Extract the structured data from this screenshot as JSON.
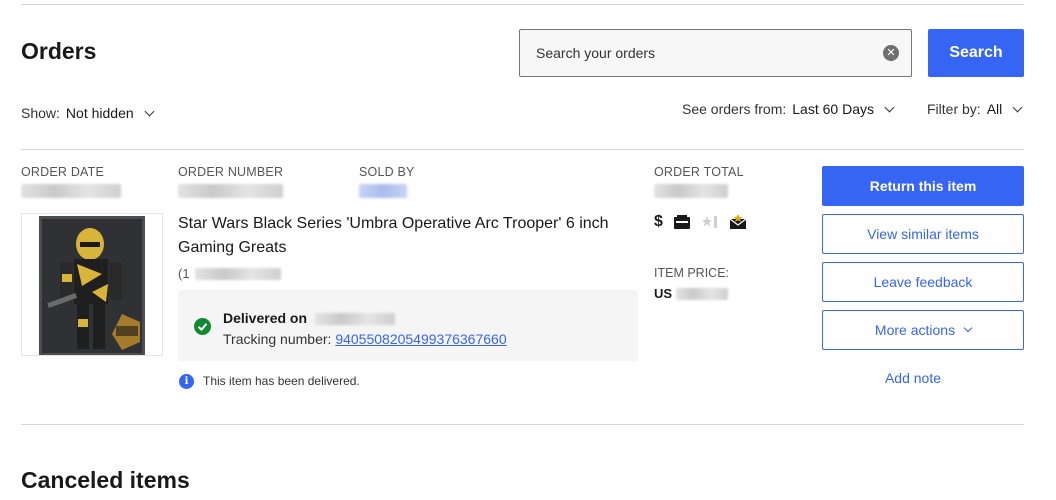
{
  "header": {
    "title": "Orders",
    "search_placeholder": "Search your orders",
    "search_button": "Search"
  },
  "filters": {
    "show_label": "Show:",
    "show_value": "Not hidden",
    "orders_from_label": "See orders from:",
    "orders_from_value": "Last 60 Days",
    "filter_label": "Filter by:",
    "filter_value": "All"
  },
  "order": {
    "headers": {
      "order_date": "ORDER DATE",
      "order_number": "ORDER NUMBER",
      "sold_by": "SOLD BY",
      "order_total": "ORDER TOTAL"
    },
    "item_title": "Star Wars Black Series 'Umbra Operative Arc Trooper' 6 inch Gaming Greats",
    "item_id_prefix": "(1",
    "delivered_label": "Delivered on",
    "tracking_label": "Tracking number:",
    "tracking_number": "9405508205499376367660",
    "info_text": "This item has been delivered.",
    "item_price_label": "ITEM PRICE:",
    "item_price_currency": "US",
    "icons": [
      "dollar-icon",
      "package-icon",
      "feedback-star-icon",
      "message-icon"
    ],
    "actions": {
      "return": "Return this item",
      "similar": "View similar items",
      "feedback": "Leave feedback",
      "more": "More actions",
      "note": "Add note"
    }
  },
  "sections": {
    "canceled": "Canceled items"
  },
  "colors": {
    "accent": "#3665f3",
    "delivered_green": "#118a32",
    "panel_bg": "#f5f5f5"
  }
}
